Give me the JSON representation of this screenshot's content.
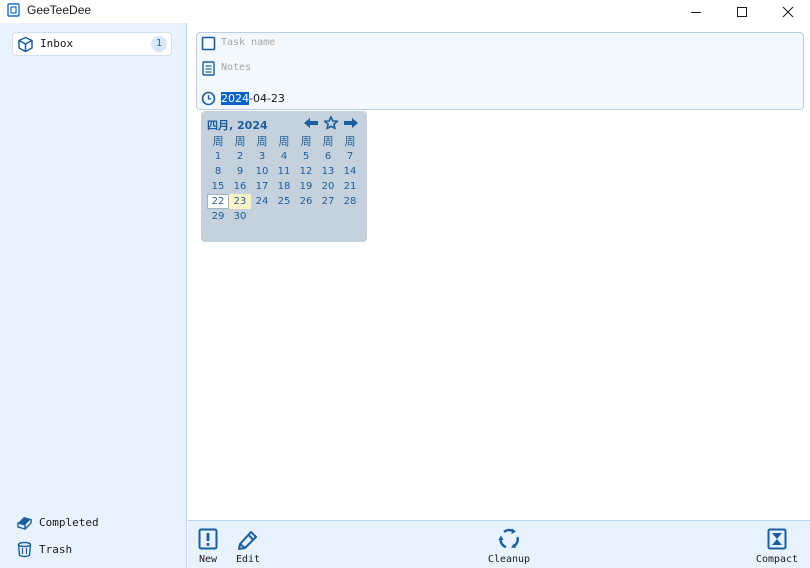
{
  "window": {
    "title": "GeeTeeDee",
    "minimize_icon": "minimize-icon",
    "maximize_icon": "maximize-icon",
    "close_icon": "close-icon"
  },
  "sidebar": {
    "inbox": {
      "label": "Inbox",
      "count": "1",
      "icon": "box-icon"
    },
    "completed": {
      "label": "Completed",
      "icon": "completed-icon"
    },
    "trash": {
      "label": "Trash",
      "icon": "trash-icon"
    }
  },
  "task_form": {
    "name_placeholder": "Task name",
    "notes_placeholder": "Notes",
    "date_selected": "2024",
    "date_rest": "-04-23"
  },
  "calendar": {
    "title": "四月, 2024",
    "weekday_headers": [
      "周",
      "周",
      "周",
      "周",
      "周",
      "周",
      "周"
    ],
    "weeks": [
      [
        "1",
        "2",
        "3",
        "4",
        "5",
        "6",
        "7"
      ],
      [
        "8",
        "9",
        "10",
        "11",
        "12",
        "13",
        "14"
      ],
      [
        "15",
        "16",
        "17",
        "18",
        "19",
        "20",
        "21"
      ],
      [
        "22",
        "23",
        "24",
        "25",
        "26",
        "27",
        "28"
      ],
      [
        "29",
        "30",
        "",
        "",
        "",
        "",
        ""
      ]
    ],
    "selected_day": "22",
    "today_day": "23"
  },
  "toolbar": {
    "new_label": "New",
    "edit_label": "Edit",
    "cleanup_label": "Cleanup",
    "compact_label": "Compact"
  },
  "colors": {
    "accent": "#1b5e9c",
    "sidebar_bg": "#e8f2fd",
    "selection": "#0b62c5",
    "today_highlight": "#fdf3c7"
  }
}
